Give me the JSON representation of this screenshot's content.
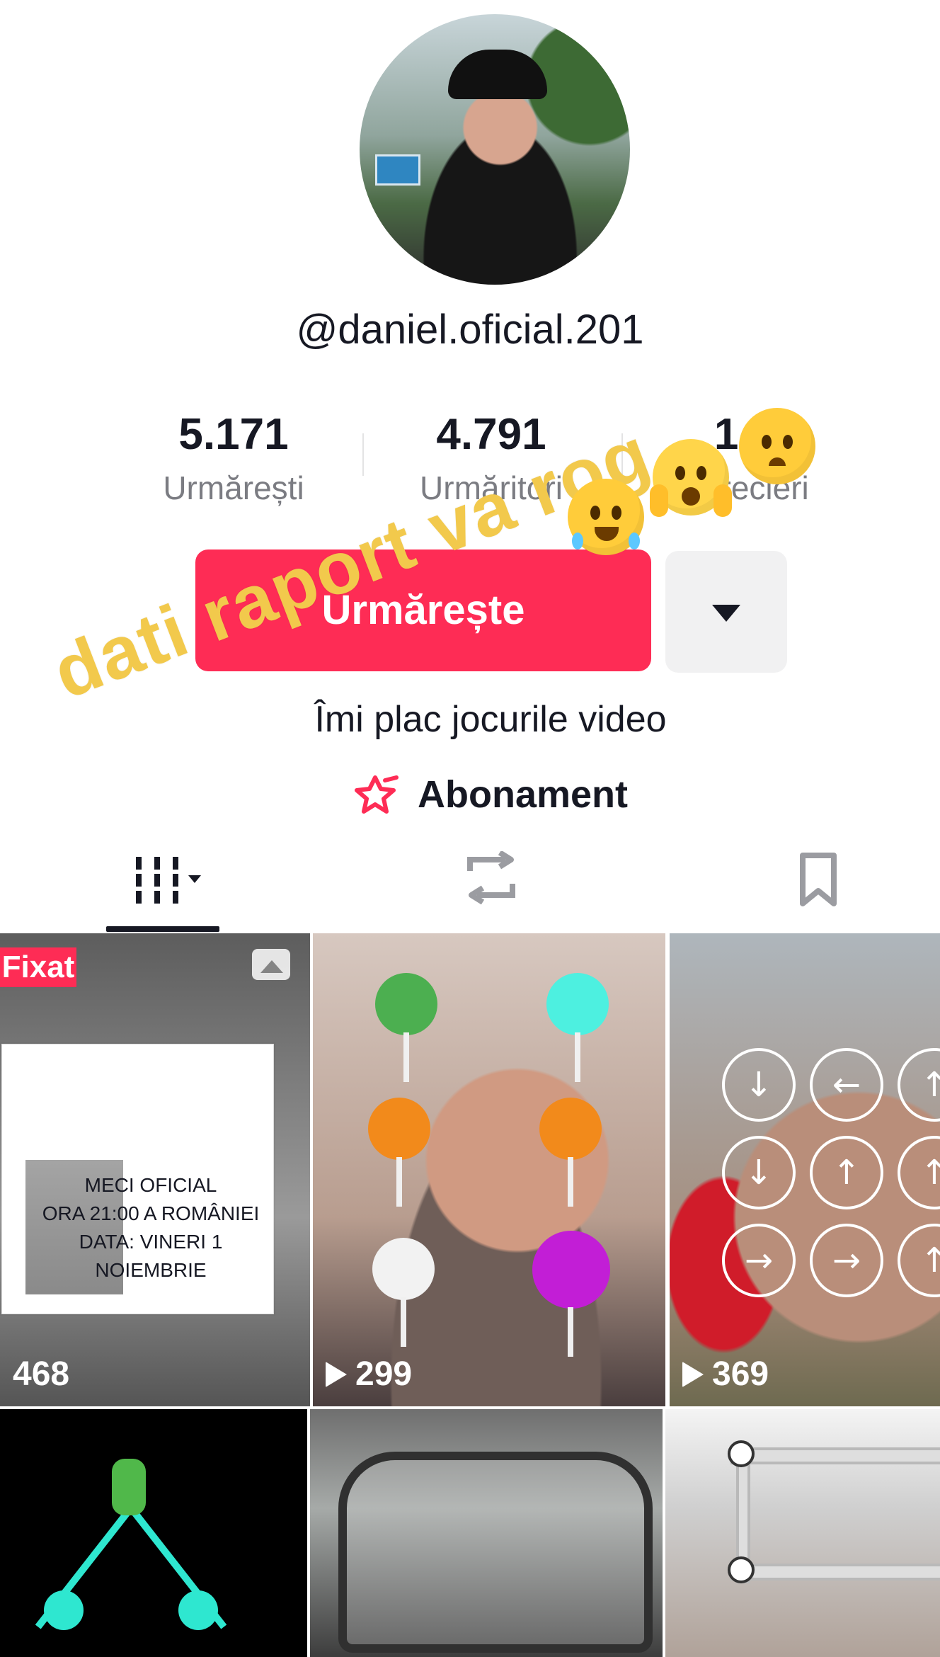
{
  "profile": {
    "username": "@daniel.oficial.201",
    "stats": [
      {
        "value": "5.171",
        "label": "Urmărești"
      },
      {
        "value": "4.791",
        "label": "Urmăritori"
      },
      {
        "value": "1.6",
        "label": "Aprecieri"
      }
    ],
    "follow_label": "Urmărește",
    "bio": "Îmi plac jocurile video",
    "subscription_label": "Abonament"
  },
  "overlay_text": "dati raport va rog",
  "tabs": [
    {
      "name": "videos",
      "icon": "grid-icon",
      "active": true
    },
    {
      "name": "reposts",
      "icon": "repost-icon",
      "active": false
    },
    {
      "name": "saved",
      "icon": "bookmark-icon",
      "active": false
    }
  ],
  "grid": [
    {
      "pinned_label": "Fixat",
      "views": "468",
      "caption": "MECI OFICIAL\nORA 21:00 A ROMÂNIEI\nDATA: VINERI 1\nNOIEMBRIE"
    },
    {
      "views": "299"
    },
    {
      "views": "369"
    },
    {
      "views": ""
    },
    {
      "views": ""
    },
    {
      "views": ""
    }
  ],
  "colors": {
    "accent": "#fe2c55",
    "overlay": "#f2c94c",
    "text": "#161823",
    "muted": "#7b7c82"
  }
}
